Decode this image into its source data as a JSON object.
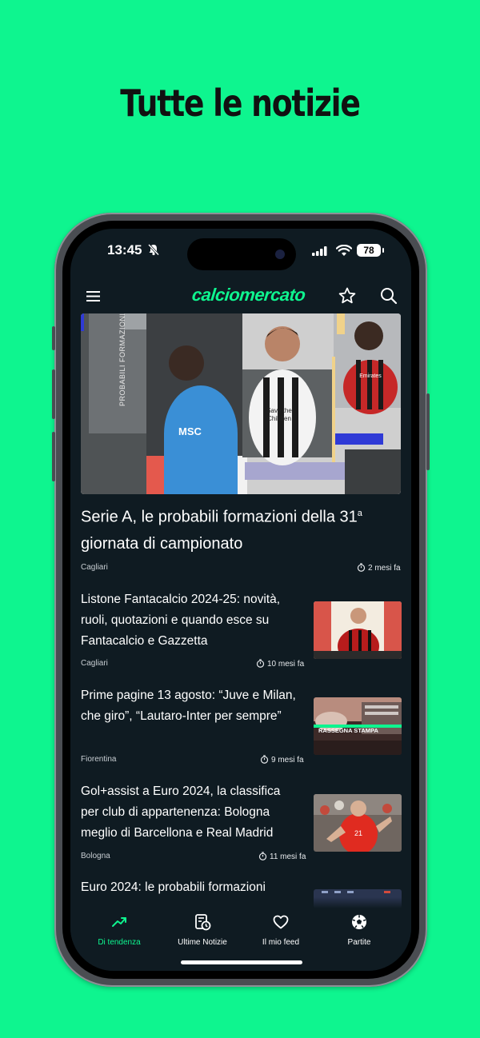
{
  "promo": {
    "headline": "Tutte le notizie"
  },
  "status_bar": {
    "time": "13:45",
    "battery": "78"
  },
  "app_bar": {
    "logo": "calciomercato"
  },
  "hero": {
    "title_main": "Serie A, le probabili formazioni della 31",
    "title_sup": "a",
    "title_rest": " giornata di campionato",
    "tag": "Cagliari",
    "time": "2 mesi fa",
    "image_text": "PROBABILI FORMAZIONI"
  },
  "articles": [
    {
      "title": "Listone Fantacalcio 2024-25: novità, ruoli, quotazioni e quando esce su Fantacalcio e Gazzetta",
      "tag": "Cagliari",
      "time": "10 mesi fa"
    },
    {
      "title": "Prime pagine 13 agosto: “Juve e Milan, che giro”, “Lautaro-Inter per sempre”",
      "tag": "Fiorentina",
      "time": "9 mesi fa",
      "thumb_text": "RASSEGNA STAMPA"
    },
    {
      "title": "Gol+assist a Euro 2024, la classifica per club di appartenenza: Bologna meglio di Barcellona e Real Madrid",
      "tag": "Bologna",
      "time": "11 mesi fa"
    },
    {
      "title": "Euro 2024: le probabili formazioni"
    }
  ],
  "tabs": [
    {
      "label": "Di tendenza",
      "icon": "trending-icon"
    },
    {
      "label": "Ultime Notizie",
      "icon": "latest-news-icon"
    },
    {
      "label": "Il mio feed",
      "icon": "heart-icon"
    },
    {
      "label": "Partite",
      "icon": "soccer-ball-icon"
    }
  ],
  "colors": {
    "accent": "#0ef58f",
    "screen_bg": "#0f1b22"
  }
}
